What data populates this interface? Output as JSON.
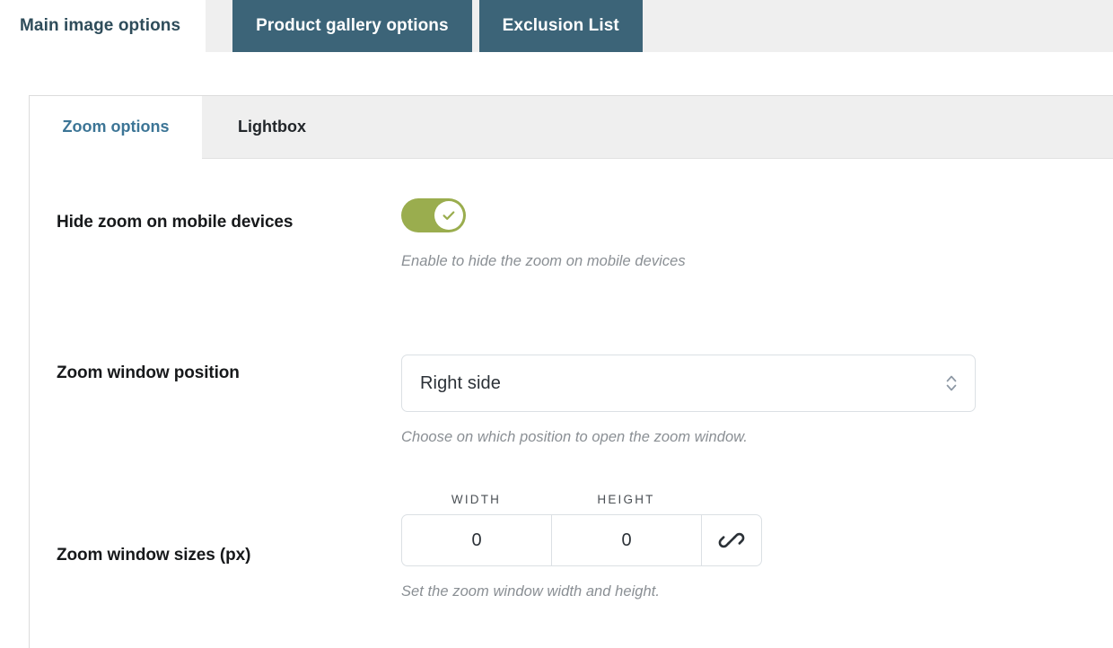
{
  "top_tabs": [
    {
      "label": "Main image options",
      "active": true
    },
    {
      "label": "Product gallery options",
      "active": false
    },
    {
      "label": "Exclusion List",
      "active": false
    }
  ],
  "sub_tabs": [
    {
      "label": "Zoom options",
      "active": true
    },
    {
      "label": "Lightbox",
      "active": false
    }
  ],
  "settings": {
    "hide_zoom_mobile": {
      "label": "Hide zoom on mobile devices",
      "hint": "Enable to hide the zoom on mobile devices",
      "toggle_state": "on",
      "toggle_icon": "check-icon"
    },
    "zoom_window_position": {
      "label": "Zoom window position",
      "hint": "Choose on which position to open the zoom window.",
      "value": "Right side",
      "stepper_icon": "chevron-up-down-icon"
    },
    "zoom_window_sizes": {
      "label": "Zoom window sizes (px)",
      "hint": "Set the zoom window width and height.",
      "width_header": "Width",
      "height_header": "Height",
      "width_value": "0",
      "height_value": "0",
      "link_icon": "link-icon"
    }
  },
  "colors": {
    "tab_active_bg": "#ffffff",
    "tab_inactive_bg": "#3c6478",
    "topbar_bg": "#efefef",
    "subtab_active_text": "#3c7596",
    "toggle_on": "#9aad4e",
    "hint_text": "#8a8f94",
    "label_text": "#17191b"
  }
}
